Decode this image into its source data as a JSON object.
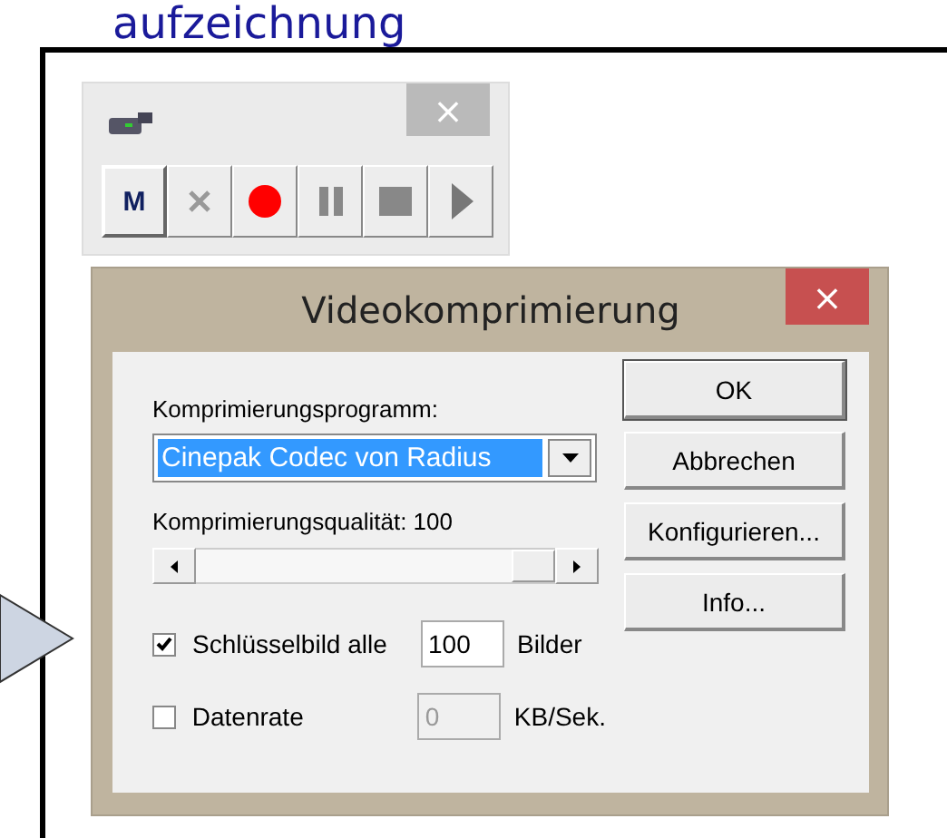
{
  "heading": "aufzeichnung",
  "toolbar": {
    "close": "×",
    "buttons": [
      {
        "kind": "mode",
        "label": "M"
      },
      {
        "kind": "cancel"
      },
      {
        "kind": "record"
      },
      {
        "kind": "pause"
      },
      {
        "kind": "stop"
      },
      {
        "kind": "play"
      }
    ]
  },
  "dialog": {
    "title": "Videokomprimierung",
    "close": "×",
    "compressor_label": "Komprimierungsprogramm:",
    "compressor": "Cinepak Codec von Radius",
    "quality_label": "Komprimierungsqualität: 100",
    "quality": {
      "level": 1
    },
    "options": [
      {
        "label": "Schlüsselbild alle",
        "checked": true,
        "value": "100",
        "unit": "Bilder",
        "disabled": false
      },
      {
        "label": "Datenrate",
        "checked": false,
        "value": "0",
        "unit": "KB/Sek.",
        "disabled": true
      }
    ],
    "buttons": [
      "OK",
      "Abbrechen",
      "Konfigurieren...",
      "Info..."
    ]
  }
}
